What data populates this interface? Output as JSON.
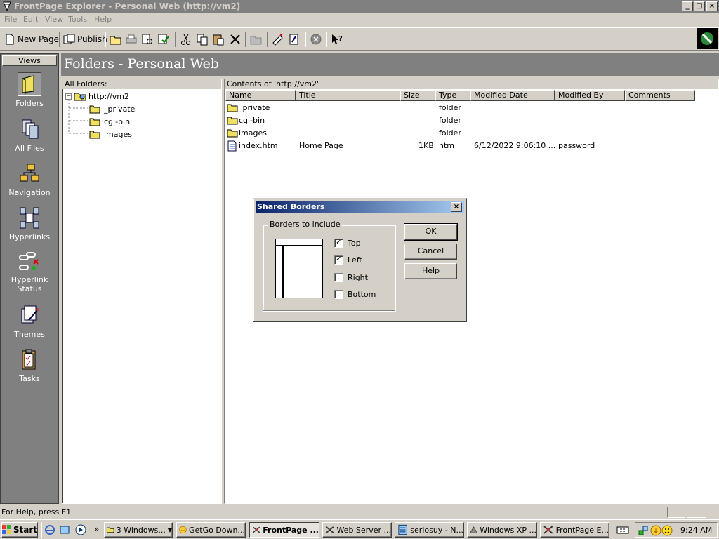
{
  "window": {
    "title": "FrontPage Explorer - Personal Web (http://vm2)",
    "controls": {
      "minimize": "_",
      "maximize": "□",
      "close": "×"
    }
  },
  "menu": [
    "File",
    "Edit",
    "View",
    "Tools",
    "Help"
  ],
  "toolbar": {
    "new_page": "New Page",
    "publish": "Publish"
  },
  "views": {
    "header": "Views",
    "items": [
      {
        "label": "Folders",
        "icon": "folder-icon",
        "selected": true
      },
      {
        "label": "All Files",
        "icon": "files-icon"
      },
      {
        "label": "Navigation",
        "icon": "navigation-icon"
      },
      {
        "label": "Hyperlinks",
        "icon": "hyperlinks-icon"
      },
      {
        "label": "Hyperlink Status",
        "icon": "broken-link-icon"
      },
      {
        "label": "Themes",
        "icon": "themes-icon"
      },
      {
        "label": "Tasks",
        "icon": "tasks-icon"
      }
    ]
  },
  "main": {
    "header": "Folders - Personal Web"
  },
  "tree": {
    "header": "All Folders:",
    "root": "http://vm2",
    "expander": "−",
    "children": [
      "_private",
      "cgi-bin",
      "images"
    ]
  },
  "contents": {
    "header": "Contents of 'http://vm2'",
    "columns": [
      "Name",
      "Title",
      "Size",
      "Type",
      "Modified Date",
      "Modified By",
      "Comments"
    ],
    "rows": [
      {
        "name": "_private",
        "title": "",
        "size": "",
        "type": "folder",
        "date": "",
        "by": "",
        "icon": "folder-icon"
      },
      {
        "name": "cgi-bin",
        "title": "",
        "size": "",
        "type": "folder",
        "date": "",
        "by": "",
        "icon": "folder-icon"
      },
      {
        "name": "images",
        "title": "",
        "size": "",
        "type": "folder",
        "date": "",
        "by": "",
        "icon": "folder-icon"
      },
      {
        "name": "index.htm",
        "title": "Home Page",
        "size": "1KB",
        "type": "htm",
        "date": "6/12/2022 9:06:10 ...",
        "by": "password",
        "icon": "html-file-icon"
      }
    ]
  },
  "dialog": {
    "title": "Shared Borders",
    "close": "×",
    "group_label": "Borders to include",
    "options": [
      {
        "label": "Top",
        "checked": true
      },
      {
        "label": "Left",
        "checked": true
      },
      {
        "label": "Right",
        "checked": false
      },
      {
        "label": "Bottom",
        "checked": false
      }
    ],
    "checkmark": "✓",
    "ok": "OK",
    "cancel": "Cancel",
    "help": "Help"
  },
  "status": {
    "text": "For Help, press F1"
  },
  "taskbar": {
    "start": "Start",
    "more": "»",
    "tasks": [
      {
        "label": "3 Windows...",
        "icon": "folder-icon"
      },
      {
        "label": "GetGo Down...",
        "icon": "download-icon"
      },
      {
        "label": "FrontPage ...",
        "icon": "frontpage-icon",
        "active": true
      },
      {
        "label": "Web Server ...",
        "icon": "server-icon"
      },
      {
        "label": "seriosuy - N...",
        "icon": "notepad-icon"
      },
      {
        "label": "Windows XP ...",
        "icon": "vm-icon"
      },
      {
        "label": "FrontPage E...",
        "icon": "frontpage-icon"
      }
    ],
    "clock": "9:24 AM"
  }
}
